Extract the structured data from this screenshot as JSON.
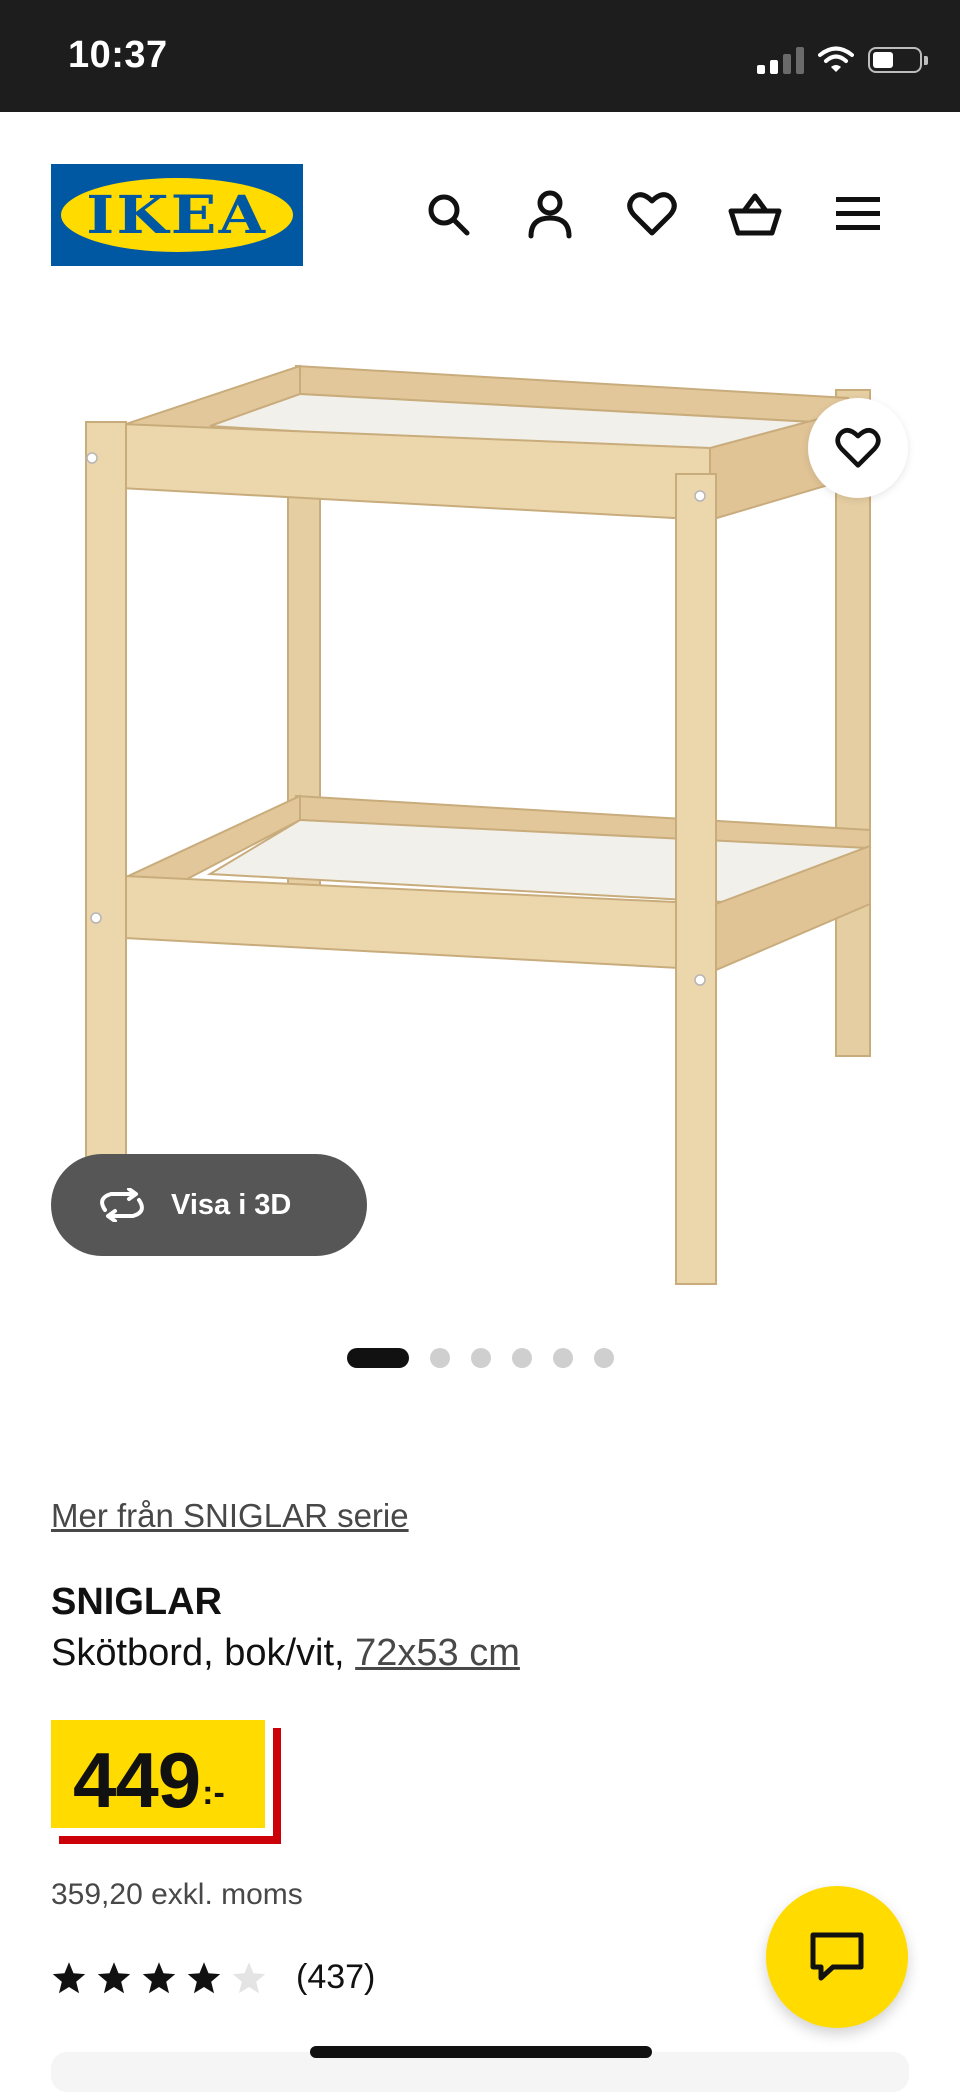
{
  "status_bar": {
    "time": "10:37",
    "icons": [
      "signal-icon",
      "wifi-icon",
      "battery-icon"
    ]
  },
  "header": {
    "logo_text": "IKEA",
    "icons": [
      "search-icon",
      "account-icon",
      "favourites-icon",
      "shopping-basket-icon",
      "menu-icon"
    ]
  },
  "gallery": {
    "view_3d_label": "Visa i 3D",
    "image_count": 6,
    "active_index": 0
  },
  "product": {
    "series_link": "Mer från SNIGLAR serie",
    "name": "SNIGLAR",
    "description": "Skötbord, bok/vit,",
    "size_link": "72x53 cm",
    "price": "449",
    "price_suffix": ":-",
    "price_excl_vat": "359,20 exkl. moms",
    "rating": 4,
    "rating_max": 5,
    "review_count": "(437)"
  },
  "colors": {
    "ikea_blue": "#0058a3",
    "ikea_yellow": "#ffdb00",
    "price_red": "#cc0008",
    "wood": "#ecd6ac"
  }
}
